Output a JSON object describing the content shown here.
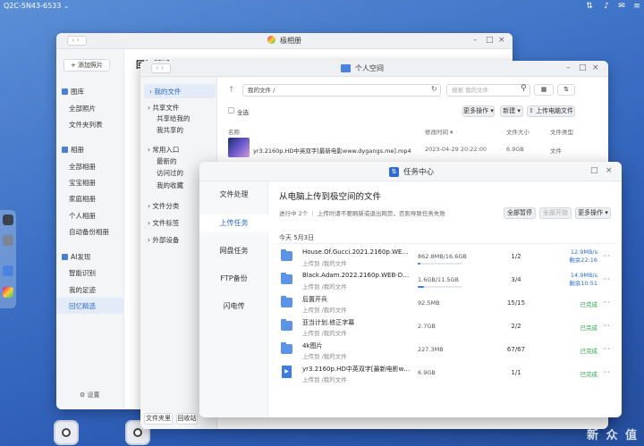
{
  "topbar": {
    "device": "Q2C-5N43-6533 ⌄",
    "icons": [
      "transfer-icon",
      "bell-icon",
      "mail-icon",
      "user-icon",
      "menu-icon"
    ]
  },
  "album": {
    "title": "极相册",
    "add_photo": "+ 添加照片",
    "heading_partial": "回忆精选",
    "library": "图库",
    "lib_items": [
      "全部照片",
      "文件夹列表"
    ],
    "albums": "相册",
    "album_items": [
      "全部相册",
      "宝宝相册",
      "家庭相册",
      "个人相册",
      "自动备份相册"
    ],
    "ai": "AI发现",
    "ai_items": [
      "智能识别",
      "我的足迹",
      "回忆精选"
    ],
    "settings": "设置"
  },
  "space": {
    "title": "个人空间",
    "side": {
      "my_files": "我的文件",
      "shared_files": "共享文件",
      "shared_sub": [
        "共享给我的",
        "我共享的"
      ],
      "common": "常用入口",
      "common_sub": [
        "最新的",
        "访问过的",
        "我的收藏"
      ],
      "file_cat": "文件分类",
      "file_tags": "文件标签",
      "external": "外部设备",
      "bottom": [
        "文件夹里",
        "回收站"
      ]
    },
    "path": "我的文件 /",
    "search_placeholder": "搜索 我的文件",
    "select_all": "全选",
    "more_ops": "更多操作 ▾",
    "new": "新建 ▾",
    "upload_pc": "上传电脑文件",
    "cols": {
      "name": "名称",
      "modified": "修改时间 ▾",
      "size": "文件大小",
      "type": "文件类型"
    },
    "file": {
      "name": "yr3.2160p.HD中英双字[最新电影www.dygangs.me].mp4",
      "modified": "2023-04-29 20:22:00",
      "size": "6.9GB",
      "type": "文件"
    }
  },
  "tasks": {
    "title": "任务中心",
    "tabs": [
      "文件处理",
      "上传任务",
      "网盘任务",
      "FTP备份",
      "闪电传"
    ],
    "heading": "从电脑上传到极空间的文件",
    "summary": "进行中 2个 ｜ 上传时请不要刷新或退出网页，否则导致任务失败",
    "pause_all": "全部暂停",
    "start_all": "全部开始",
    "more_ops": "更多操作 ▾",
    "date": "今天 5月3日",
    "rows": [
      {
        "icon": "folder-icon",
        "name": "House.Of.Gucci.2021.2160p.WEB-DL.x265.10bit...",
        "path": "上传到 /我的文件",
        "size": "862.8MB/16.6GB",
        "progress": 0.05,
        "count": "1/2",
        "status": "12.9MB/s",
        "status2": "剩余22:16",
        "uploading": true
      },
      {
        "icon": "folder-icon",
        "name": "Black.Adam.2022.2160p.WEB-DL.x265.10bit.HDR",
        "path": "上传到 /我的文件",
        "size": "1.6GB/11.5GB",
        "progress": 0.14,
        "count": "3/4",
        "status": "14.9MB/s",
        "status2": "剩余10:51",
        "uploading": true
      },
      {
        "icon": "folder-icon",
        "name": "后置开兵",
        "path": "上传到 /我的文件",
        "size": "92.5MB",
        "count": "15/15",
        "status": "已完成"
      },
      {
        "icon": "folder-icon",
        "name": "亚当计划.修正字幕",
        "path": "上传到 /我的文件",
        "size": "2.7GB",
        "count": "2/2",
        "status": "已完成"
      },
      {
        "icon": "folder-icon",
        "name": "4k图片",
        "path": "上传到 /我的文件",
        "size": "227.3MB",
        "count": "67/67",
        "status": "已完成"
      },
      {
        "icon": "video-file-icon",
        "name": "yr3.2160p.HD中英双字[最新电影www.dygangs.me].mp4",
        "path": "上传到 /我的文件",
        "size": "6.9GB",
        "count": "1/1",
        "status": "已完成"
      }
    ]
  },
  "watermark": "新 众 值"
}
